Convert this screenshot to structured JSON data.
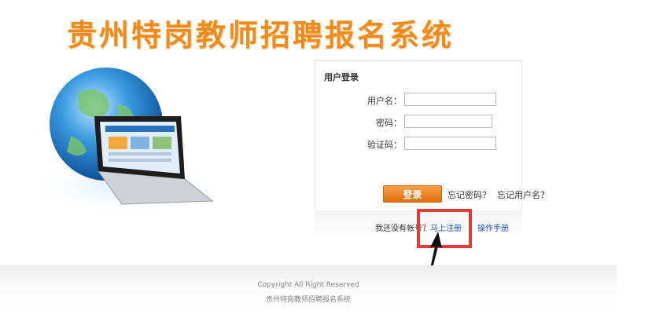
{
  "header": {
    "title": "贵州特岗教师招聘报名系统"
  },
  "login": {
    "title": "用户登录",
    "username_label": "用户名：",
    "password_label": "密码：",
    "captcha_label": "验证码：",
    "username_value": "",
    "password_value": "",
    "captcha_value": "",
    "login_button": "登录",
    "forgot_password": "忘记密码？",
    "forgot_username": "忘记用户名？"
  },
  "register": {
    "prompt": "我还没有帐号？",
    "register_link": "马上注册",
    "manual_link": "操作手册"
  },
  "footer": {
    "copyright": "Copyright All Right Reserved",
    "system_name": "贵州特岗教师招聘报名系统"
  },
  "colors": {
    "brand_orange": "#f08a1c",
    "button_orange": "#e26d0d",
    "link_blue": "#1a58b6",
    "highlight_red": "#e53a3a"
  },
  "icons": {
    "hero": "globe-laptop-illustration",
    "annotation": "arrow-icon"
  }
}
